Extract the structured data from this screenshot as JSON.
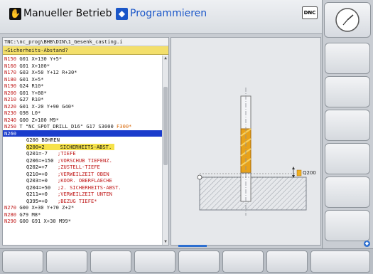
{
  "header": {
    "mode_manual": "Manueller Betrieb",
    "mode_program": "Programmieren",
    "dnc_label": "DNC"
  },
  "program": {
    "path": "TNC:\\nc_prog\\BHB\\DIN\\1_Gesenk_casting.i",
    "question": "→Sicherheits-Abstand?",
    "lines": [
      {
        "num": "N150",
        "text": " G01 X+130 Y+5*"
      },
      {
        "num": "N160",
        "text": " G01 X+100*"
      },
      {
        "num": "N170",
        "text": " G03 X+50 Y+12 R+30*"
      },
      {
        "num": "N180",
        "text": " G01 X+5*"
      },
      {
        "num": "N190",
        "text": " G24 R10*"
      },
      {
        "num": "N200",
        "text": " G01 Y+80*"
      },
      {
        "num": "N210",
        "text": " G27 R10*"
      },
      {
        "num": "N220",
        "text": " G01 X-20 Y+90 G40*"
      },
      {
        "num": "N230",
        "text": " G98 L0*"
      },
      {
        "num": "N240",
        "text": " G00 Z+100 M9*"
      },
      {
        "num": "N250",
        "text": " T \"NC_SPOT_DRILL_D16\" G17 S3000 ",
        "extra": "F300*"
      },
      {
        "num": "N260",
        "text": "",
        "current": true
      }
    ],
    "cycle": {
      "title": "G200 BOHREN",
      "params": [
        {
          "code": "Q200=2",
          "comment": "SICHERHEITS-ABST.",
          "active": true
        },
        {
          "code": "Q201=-7",
          "comment": ";TIEFE"
        },
        {
          "code": "Q206=+150",
          "comment": ";VORSCHUB TIEFENZ."
        },
        {
          "code": "Q202=+7",
          "comment": ";ZUSTELL-TIEFE"
        },
        {
          "code": "Q210=+0",
          "comment": ";VERWEILZEIT OBEN"
        },
        {
          "code": "Q203=+0",
          "comment": ";KOOR. OBERFLAECHE"
        },
        {
          "code": "Q204=+50",
          "comment": ";2. SICHERHEITS-ABST."
        },
        {
          "code": "Q211=+0",
          "comment": ";VERWEILZEIT UNTEN"
        },
        {
          "code": "Q395=+0",
          "comment": ";BEZUG TIEFE*"
        }
      ]
    },
    "tail_lines": [
      {
        "num": "N270",
        "text": " G00 X+30 Y+70 Z+2*"
      },
      {
        "num": "N280",
        "text": " G79 M8*"
      },
      {
        "num": "N290",
        "text": " G00 G91 X+30 M99*"
      }
    ]
  },
  "graphic": {
    "param_label": "Q200"
  },
  "colors": {
    "accent_blue": "#1a56c8",
    "line_number_red": "#c01a1a",
    "highlight_yellow": "#f6e24a",
    "current_line_blue": "#1a3ccc",
    "drill_orange": "#e8a21a"
  }
}
